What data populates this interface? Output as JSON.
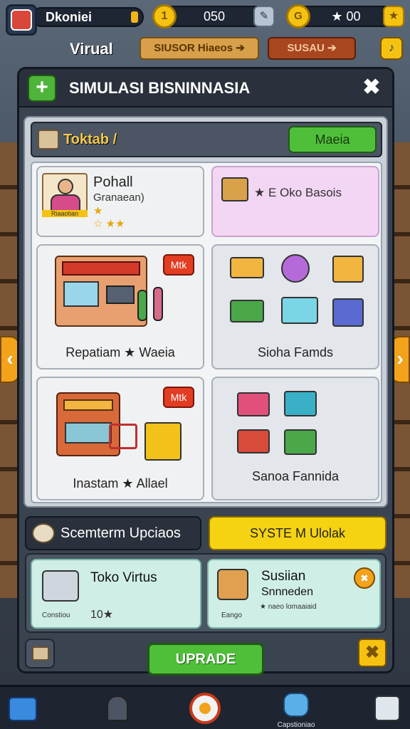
{
  "hud": {
    "player_name": "Dkoniei",
    "coins": "050",
    "stars": "★ 00",
    "subtitle": "Virual",
    "btn_shop": "SIUSOR Hiaeos ➔",
    "btn_susau": "SUSAU ➔",
    "colors": {
      "accent": "#f5c211",
      "panel": "#3a4350"
    }
  },
  "panel": {
    "title": "SIMULASI BISNINNASIA",
    "plus_label": "+",
    "close_label": "✖",
    "section_title": "Toktab /",
    "section_button": "Maeia"
  },
  "cards": {
    "profile": {
      "name": "Pohall",
      "subtitle": "Granaean)",
      "badge": "Riaaotian",
      "stars_line1": "★",
      "stars_line2": "☆ ★★"
    },
    "pink": {
      "label": "★ E Oko Basois"
    },
    "store_scene": {
      "badge": "Mtk",
      "caption": "Repatiam ★ Waeia"
    },
    "items_panel": {
      "caption": "Sioha Famds"
    },
    "market_scene": {
      "badge": "Mtk",
      "caption": "Inastam ★ Allael"
    },
    "stacks_panel": {
      "caption": "Sanoa Fannida"
    }
  },
  "upgrades": {
    "title": "Scemterm Upciaos",
    "system_button": "SYSTE M Ulolak",
    "card1": {
      "name": "Toko Virtus",
      "sub": "Constiou",
      "value": "10★"
    },
    "card2": {
      "name_line1": "Susiian",
      "name_line2": "Snnneden",
      "sub": "Eango",
      "small": "★ naeo lomaaiaid"
    },
    "upgrade_button": "UPRADE",
    "yx_label": "✖"
  },
  "side_arrows": {
    "left": "‹",
    "right": "›"
  },
  "nav": {
    "items": [
      {
        "icon": "back-arrow-icon",
        "label": ""
      },
      {
        "icon": "user-icon",
        "label": ""
      },
      {
        "icon": "record-icon",
        "label": ""
      },
      {
        "icon": "robot-icon",
        "label": "Capstioniao"
      },
      {
        "icon": "list-icon",
        "label": ""
      }
    ]
  }
}
